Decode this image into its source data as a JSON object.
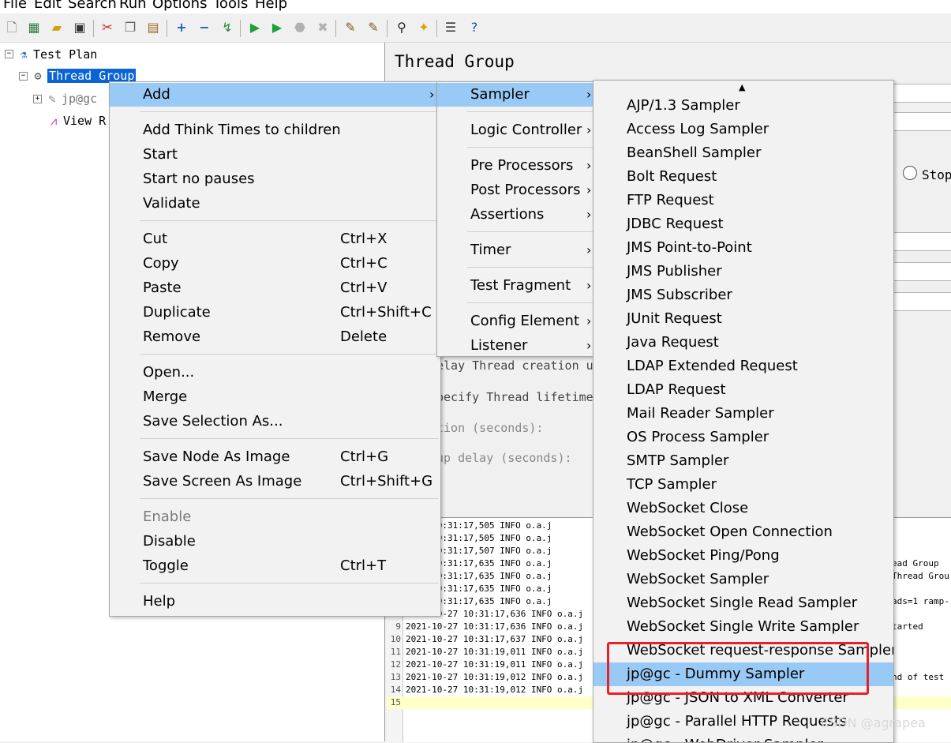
{
  "menubar": {
    "items": [
      "File",
      "Edit",
      "Search",
      "Run",
      "Options",
      "Tools",
      "Help"
    ]
  },
  "toolbar": {
    "icons": [
      "new-icon",
      "templates-icon",
      "open-icon",
      "save-icon",
      "cut-icon",
      "copy-icon",
      "paste-icon",
      "expand-icon",
      "collapse-icon",
      "toggle-icon",
      "start-icon",
      "start-no-pause-icon",
      "stop-icon",
      "shutdown-icon",
      "clear-icon",
      "clear-all-icon",
      "search-icon",
      "reset-search-icon",
      "function-helper-icon",
      "help-icon"
    ]
  },
  "tree": {
    "test_plan": "Test Plan",
    "thread_group": "Thread Group",
    "jp_gc": "jp@gc",
    "view_results": "View R"
  },
  "right": {
    "title": "Thread Group",
    "stop_radio": "Stop",
    "delay_text": "elay Thread creation u",
    "specify_text": "pecify Thread lifetime",
    "duration_text": "tion (seconds):",
    "startup_text": "up delay (seconds):",
    "log_right": [
      "ead Group",
      "Thread Grou",
      "ads=1 ramp-",
      "tarted",
      "nd of test"
    ]
  },
  "log": {
    "rows": [
      {
        "n": "",
        "t": "0-27 10:31:17,505 INFO o.a.j"
      },
      {
        "n": "",
        "t": "0-27 10:31:17,505 INFO o.a.j"
      },
      {
        "n": "",
        "t": "0-27 10:31:17,507 INFO o.a.j"
      },
      {
        "n": "",
        "t": "0-27 10:31:17,635 INFO o.a.j"
      },
      {
        "n": "",
        "t": "0-27 10:31:17,635 INFO o.a.j"
      },
      {
        "n": "",
        "t": "0-27 10:31:17,635 INFO o.a.j"
      },
      {
        "n": "",
        "t": "0-27 10:31:17,635 INFO o.a.j"
      },
      {
        "n": "",
        "t": "2021-10-27 10:31:17,636 INFO o.a.j"
      },
      {
        "n": "9",
        "t": "2021-10-27 10:31:17,636 INFO o.a.j"
      },
      {
        "n": "10",
        "t": "2021-10-27 10:31:17,637 INFO o.a.j"
      },
      {
        "n": "11",
        "t": "2021-10-27 10:31:19,011 INFO o.a.j"
      },
      {
        "n": "12",
        "t": "2021-10-27 10:31:19,011 INFO o.a.j"
      },
      {
        "n": "13",
        "t": "2021-10-27 10:31:19,012 INFO o.a.j"
      },
      {
        "n": "14",
        "t": "2021-10-27 10:31:19,012 INFO o.a.j"
      },
      {
        "n": "15",
        "t": ""
      }
    ]
  },
  "context_menu": {
    "add": "Add",
    "think_times": "Add Think Times to children",
    "start": "Start",
    "start_no_pauses": "Start no pauses",
    "validate": "Validate",
    "cut": "Cut",
    "cut_sc": "Ctrl+X",
    "copy": "Copy",
    "copy_sc": "Ctrl+C",
    "paste": "Paste",
    "paste_sc": "Ctrl+V",
    "duplicate": "Duplicate",
    "duplicate_sc": "Ctrl+Shift+C",
    "remove": "Remove",
    "remove_sc": "Delete",
    "open": "Open...",
    "merge": "Merge",
    "save_selection": "Save Selection As...",
    "save_node_image": "Save Node As Image",
    "save_node_image_sc": "Ctrl+G",
    "save_screen_image": "Save Screen As Image",
    "save_screen_image_sc": "Ctrl+Shift+G",
    "enable": "Enable",
    "disable": "Disable",
    "toggle": "Toggle",
    "toggle_sc": "Ctrl+T",
    "help": "Help"
  },
  "add_submenu": {
    "sampler": "Sampler",
    "logic_controller": "Logic Controller",
    "pre_processors": "Pre Processors",
    "post_processors": "Post Processors",
    "assertions": "Assertions",
    "timer": "Timer",
    "test_fragment": "Test Fragment",
    "config_element": "Config Element",
    "listener": "Listener"
  },
  "sampler_submenu": {
    "items": [
      "AJP/1.3 Sampler",
      "Access Log Sampler",
      "BeanShell Sampler",
      "Bolt Request",
      "FTP Request",
      "JDBC Request",
      "JMS Point-to-Point",
      "JMS Publisher",
      "JMS Subscriber",
      "JUnit Request",
      "Java Request",
      "LDAP Extended Request",
      "LDAP Request",
      "Mail Reader Sampler",
      "OS Process Sampler",
      "SMTP Sampler",
      "TCP Sampler",
      "WebSocket Close",
      "WebSocket Open Connection",
      "WebSocket Ping/Pong",
      "WebSocket Sampler",
      "WebSocket Single Read Sampler",
      "WebSocket Single Write Sampler",
      "WebSocket request-response Sampler",
      "jp@gc - Dummy Sampler",
      "jp@gc - JSON to XML Converter",
      "jp@gc - Parallel HTTP Requests",
      "jp@gc - WebDriver Sampler"
    ],
    "highlighted": "jp@gc - Dummy Sampler"
  },
  "watermark": "CSDN @agrapea"
}
